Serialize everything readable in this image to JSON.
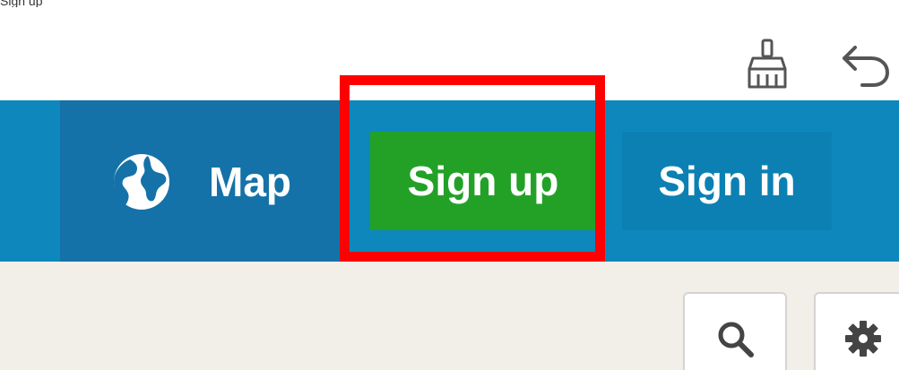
{
  "top_caption": "Sign up",
  "toolbar": {
    "broom_icon": "broom-icon",
    "undo_icon": "undo-icon"
  },
  "navbar": {
    "map_label": "Map",
    "map_icon": "globe-icon",
    "signup_label": "Sign up",
    "signin_label": "Sign in"
  },
  "map_controls": {
    "search_icon": "search-icon",
    "settings_icon": "gear-icon"
  },
  "colors": {
    "navbar": "#0e88bc",
    "map_section": "#1472a8",
    "signup_button": "#23a127",
    "signin_button": "#0c80b3",
    "highlight": "#ff0000",
    "content_bg": "#f2efe9"
  }
}
